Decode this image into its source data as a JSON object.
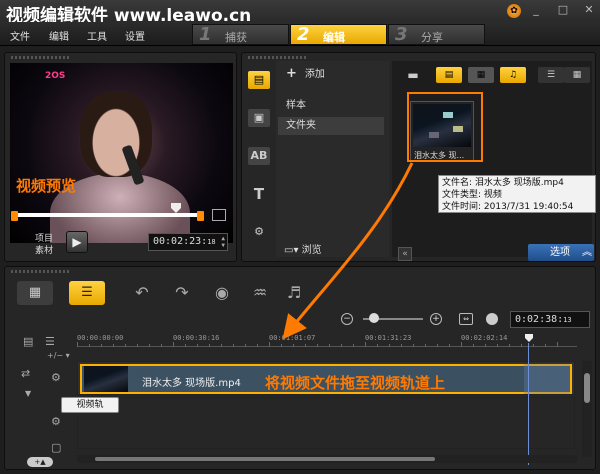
{
  "window": {
    "title": "视频编辑软件 www.leawo.cn",
    "logo_icon": "app-logo-icon",
    "controls": [
      "minimize-icon",
      "maximize-icon",
      "close-icon"
    ]
  },
  "menu": [
    "文件",
    "编辑",
    "工具",
    "设置"
  ],
  "steps": [
    {
      "num": "1",
      "label": "捕获",
      "active": false
    },
    {
      "num": "2",
      "label": "编辑",
      "active": true
    },
    {
      "num": "3",
      "label": "分享",
      "active": false
    }
  ],
  "player": {
    "overlay_label": "视频预览",
    "tv_logo": "2OS",
    "mode_project": "项目",
    "mode_clip": "素材",
    "timecode": "00:02:23:",
    "timecode_frames": "18"
  },
  "library": {
    "add_label": "添加",
    "folders": [
      {
        "label": "样本",
        "selected": false
      },
      {
        "label": "文件夹",
        "selected": true
      }
    ],
    "browse_label": "浏览",
    "thumbnail_caption": "泪水太多 现...",
    "tooltip_lines": [
      "文件名: 泪水太多 现场版.mp4",
      "文件类型: 视频",
      "文件时间: 2013/7/31 19:40:54"
    ],
    "options_label": "选项"
  },
  "timeline": {
    "timecode": "0:02:38:",
    "timecode_frames": "13",
    "ruler_labels": [
      "00:00:00:00",
      "00:00:30:16",
      "00:01:01:07",
      "00:01:31:23",
      "00:02:02:14"
    ],
    "clip_name": "泪水太多 现场版.mp4",
    "drag_hint": "将视频文件拖至视频轨道上",
    "track_tooltip": "视频轨"
  },
  "colors": {
    "accent": "#ffc61a",
    "annotation": "#ff7a00",
    "options_button": "#2a5fa0"
  }
}
